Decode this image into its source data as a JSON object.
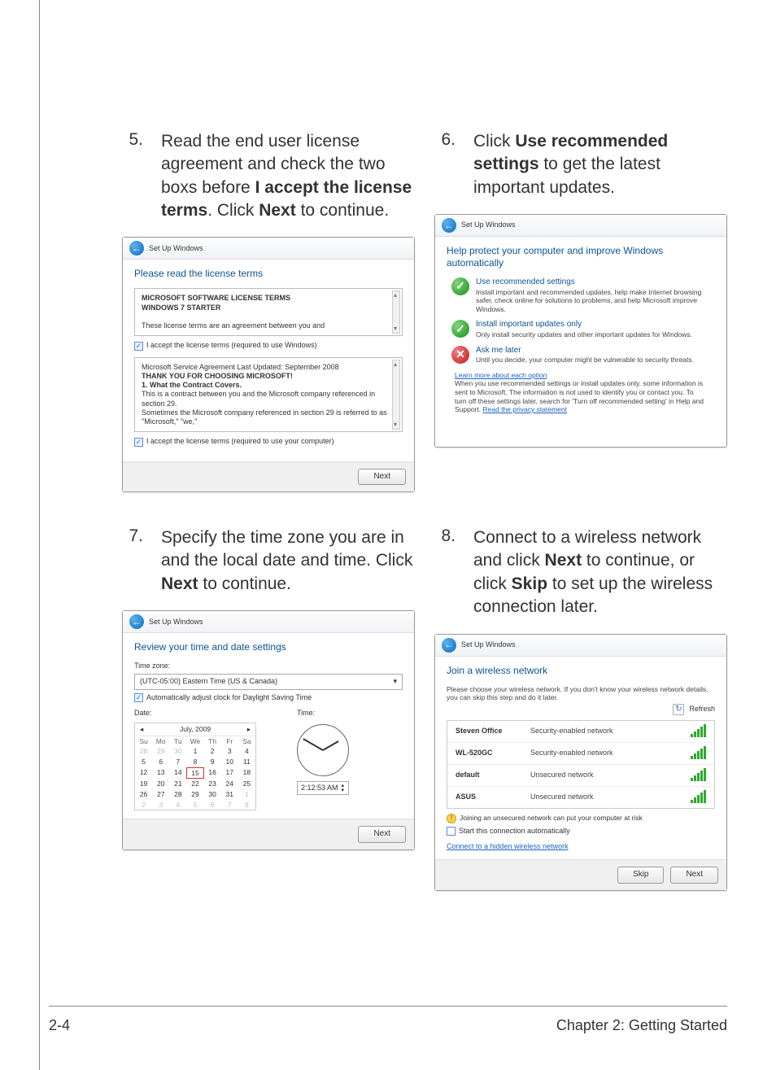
{
  "steps": {
    "s5": {
      "num": "5.",
      "text_pre": "Read the end user license agreement and check the two boxs before ",
      "b1": "I accept the license terms",
      "mid": ". Click ",
      "b2": "Next",
      "post": " to continue."
    },
    "s6": {
      "num": "6.",
      "text_pre": "Click ",
      "b1": "Use recommended settings",
      "post": " to get the latest important updates."
    },
    "s7": {
      "num": "7.",
      "text_pre": "Specify the time zone you are in and the local date and time. Click ",
      "b1": "Next",
      "post": " to continue."
    },
    "s8": {
      "num": "8.",
      "text_pre": "Connect to a wireless network and click ",
      "b1": "Next",
      "mid": " to continue, or click ",
      "b2": "Skip",
      "post": " to set up the wireless connection later."
    }
  },
  "mock5": {
    "window": "Set Up Windows",
    "heading": "Please read the license terms",
    "p1_l1": "MICROSOFT SOFTWARE LICENSE TERMS",
    "p1_l2": "WINDOWS 7 STARTER",
    "p1_l3": "These license terms are an agreement between you and",
    "chk1": "I accept the license terms (required to use Windows)",
    "p2_l1": "Microsoft Service Agreement Last Updated: September 2008",
    "p2_l2": "THANK YOU FOR CHOOSING MICROSOFT!",
    "p2_l3": "1. What the Contract Covers.",
    "p2_l4": "This is a contract between you and the Microsoft company referenced in section 29.",
    "p2_l5": "Sometimes the Microsoft company referenced in section 29 is referred to as \"Microsoft,\" \"we,\"",
    "chk2": "I accept the license terms (required to use your computer)",
    "next": "Next"
  },
  "mock6": {
    "window": "Set Up Windows",
    "heading": "Help protect your computer and improve Windows automatically",
    "opt1_t": "Use recommended settings",
    "opt1_s": "Install important and recommended updates, help make Internet browsing safer, check online for solutions to problems, and help Microsoft improve Windows.",
    "opt2_t": "Install important updates only",
    "opt2_s": "Only install security updates and other important updates for Windows.",
    "opt3_t": "Ask me later",
    "opt3_s": "Until you decide, your computer might be vulnerable to security threats.",
    "link": "Learn more about each option",
    "fine": "When you use recommended settings or install updates only, some information is sent to Microsoft. The information is not used to identify you or contact you. To turn off these settings later, search for 'Turn off recommended setting' in Help and Support. ",
    "fine_link": "Read the privacy statement"
  },
  "mock7": {
    "window": "Set Up Windows",
    "heading": "Review your time and date settings",
    "tz_label": "Time zone:",
    "tz_value": "(UTC-05:00) Eastern Time (US & Canada)",
    "dst": "Automatically adjust clock for Daylight Saving Time",
    "date_label": "Date:",
    "time_label": "Time:",
    "cal_month": "July, 2009",
    "dow": [
      "Su",
      "Mo",
      "Tu",
      "We",
      "Th",
      "Fr",
      "Sa"
    ],
    "rows": [
      [
        "28",
        "29",
        "30",
        "1",
        "2",
        "3",
        "4"
      ],
      [
        "5",
        "6",
        "7",
        "8",
        "9",
        "10",
        "11"
      ],
      [
        "12",
        "13",
        "14",
        "15",
        "16",
        "17",
        "18"
      ],
      [
        "19",
        "20",
        "21",
        "22",
        "23",
        "24",
        "25"
      ],
      [
        "26",
        "27",
        "28",
        "29",
        "30",
        "31",
        "1"
      ],
      [
        "2",
        "3",
        "4",
        "5",
        "6",
        "7",
        "8"
      ]
    ],
    "today_col": 3,
    "today_row": 2,
    "time_value": "2:12:53 AM",
    "next": "Next"
  },
  "mock8": {
    "window": "Set Up Windows",
    "heading": "Join a wireless network",
    "sub": "Please choose your wireless network. If you don't know your wireless network details, you can skip this step and do it later.",
    "refresh": "Refresh",
    "rows": [
      {
        "name": "Steven Office",
        "sec": "Security-enabled network"
      },
      {
        "name": "WL-520GC",
        "sec": "Security-enabled network"
      },
      {
        "name": "default",
        "sec": "Unsecured network"
      },
      {
        "name": "ASUS",
        "sec": "Unsecured network"
      }
    ],
    "warn": "Joining an unsecured network can put your computer at risk",
    "auto": "Start this connection automatically",
    "hidden_link": "Connect to a hidden wireless network",
    "skip": "Skip",
    "next": "Next"
  },
  "footer": {
    "left": "2-4",
    "right": "Chapter 2: Getting Started"
  }
}
